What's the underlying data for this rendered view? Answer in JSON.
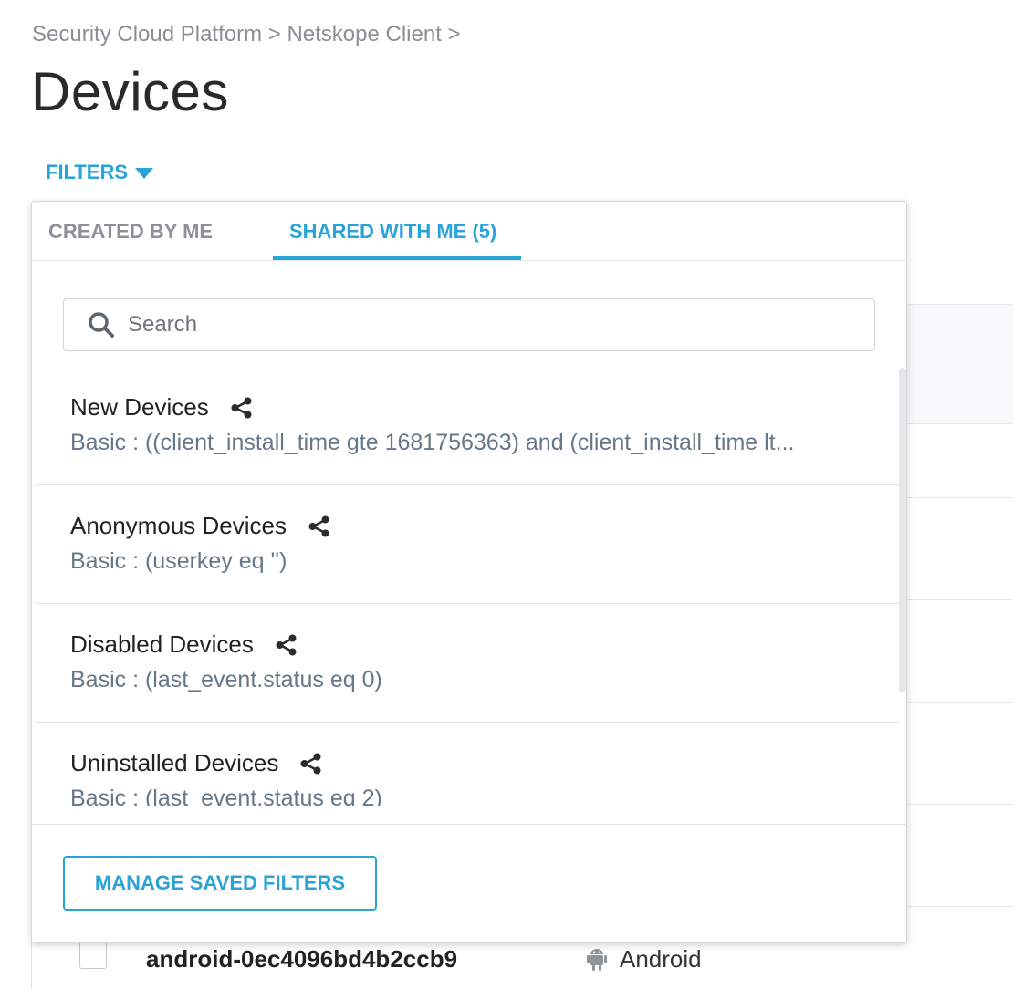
{
  "breadcrumb": "Security Cloud Platform > Netskope Client >",
  "page_title": "Devices",
  "filters_toggle": {
    "label": "FILTERS"
  },
  "popover": {
    "tabs": [
      {
        "label": "CREATED BY ME",
        "active": false
      },
      {
        "label": "SHARED WITH ME (5)",
        "active": true
      }
    ],
    "search": {
      "placeholder": "Search",
      "value": ""
    },
    "items": [
      {
        "name": "New Devices",
        "description": "Basic : ((client_install_time gte 1681756363) and (client_install_time lt...",
        "icon": "share-icon"
      },
      {
        "name": "Anonymous Devices",
        "description": "Basic : (userkey eq '')",
        "icon": "share-icon"
      },
      {
        "name": "Disabled Devices",
        "description": "Basic : (last_event.status eq 0)",
        "icon": "share-icon"
      },
      {
        "name": "Uninstalled Devices",
        "description": "Basic : (last_event.status eq 2)",
        "icon": "share-icon"
      }
    ],
    "manage_button": "MANAGE SAVED FILTERS"
  },
  "background_row": {
    "device_name": "android-0ec4096bd4b2ccb9",
    "os": "Android",
    "os_icon": "android-icon"
  },
  "colors": {
    "accent": "#2aa3d8",
    "description": "#66778a",
    "muted": "#8d9196"
  }
}
